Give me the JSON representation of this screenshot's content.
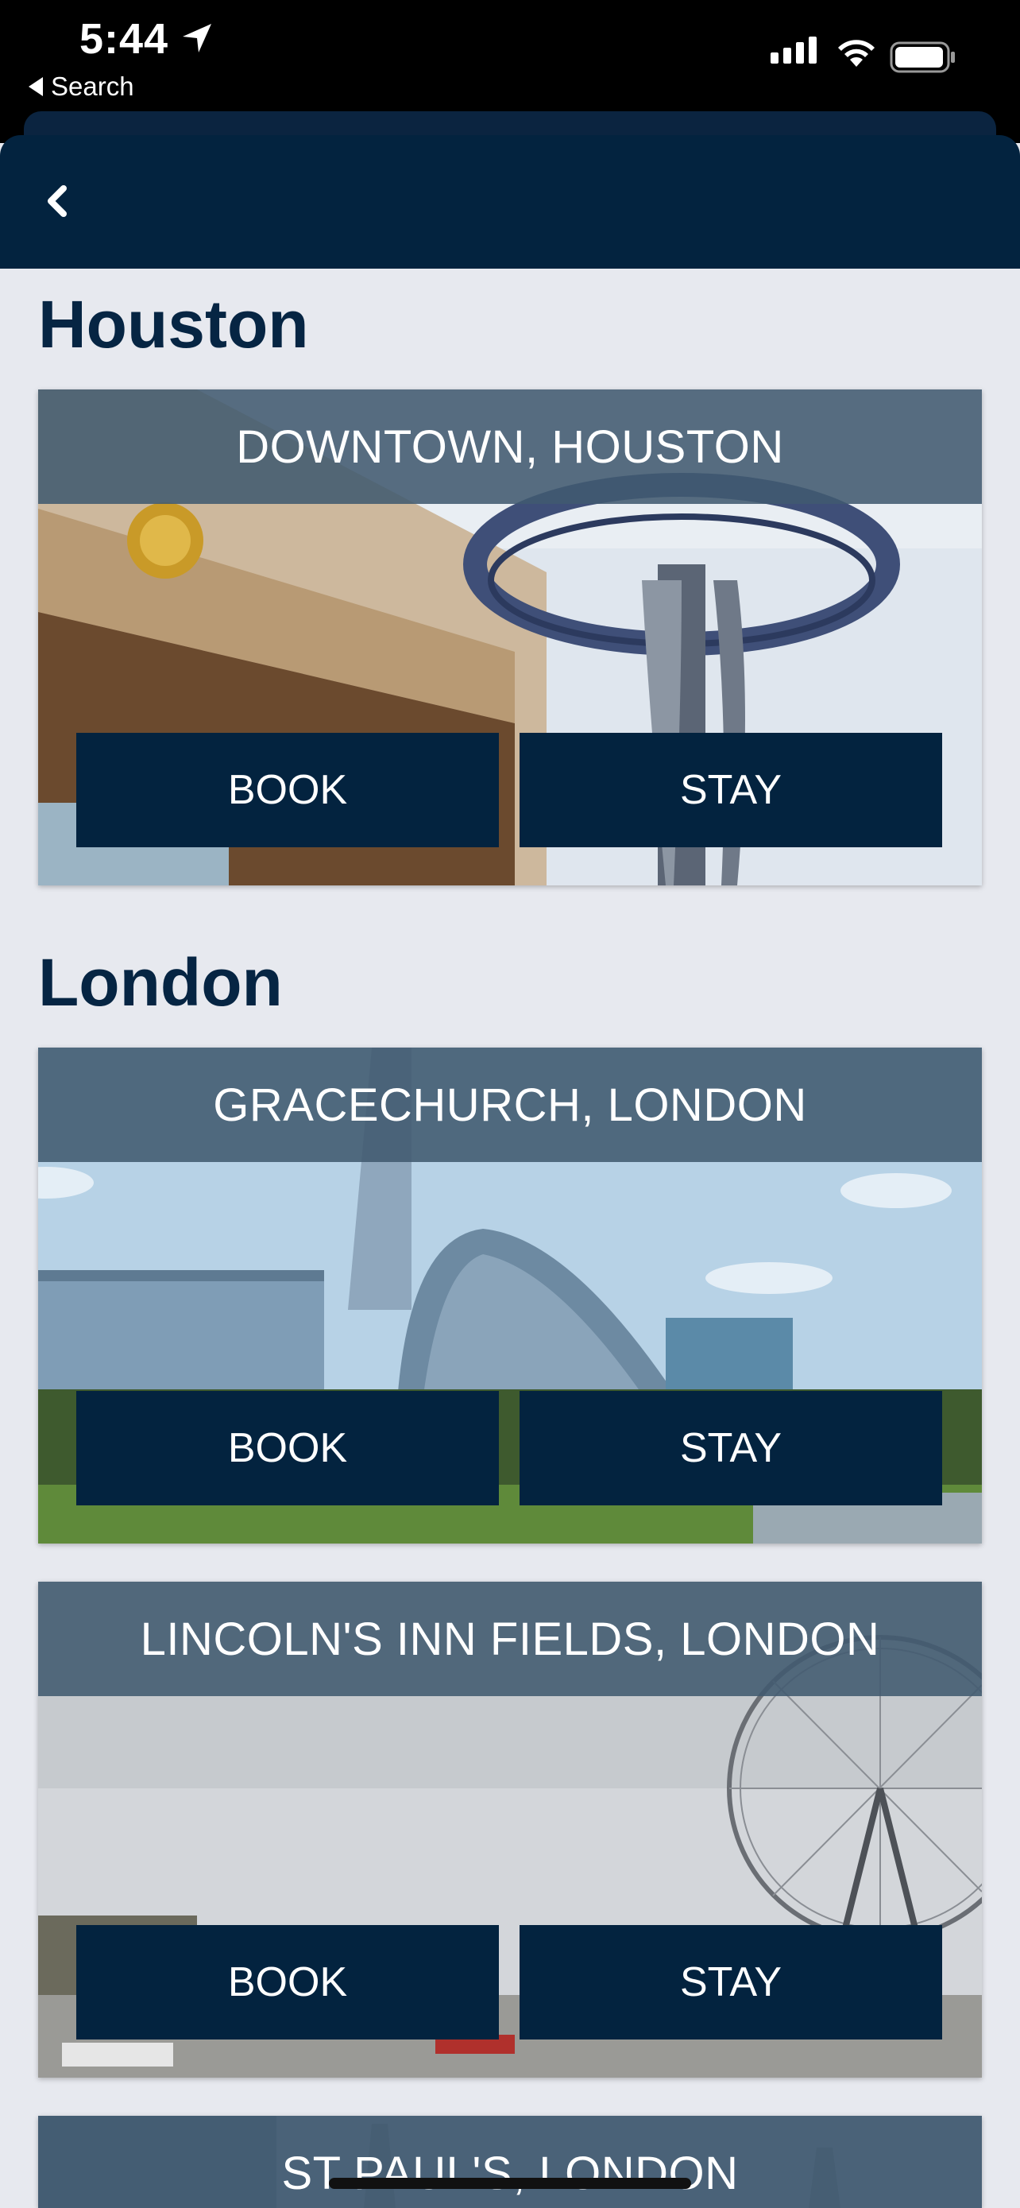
{
  "status_bar": {
    "time": "5:44",
    "back_label": "Search",
    "icons": [
      "location-arrow-icon",
      "cellular-signal-icon",
      "wifi-icon",
      "battery-icon"
    ]
  },
  "header": {
    "back_icon": "chevron-left-icon"
  },
  "colors": {
    "header_bg": "#03233f",
    "page_bg": "#e7e9ef",
    "title_band": "#415a70",
    "button_bg": "#03233f",
    "heading": "#062543"
  },
  "sections": [
    {
      "title": "Houston",
      "locations": [
        {
          "name": "DOWNTOWN, HOUSTON",
          "book_label": "BOOK",
          "stay_label": "STAY"
        }
      ]
    },
    {
      "title": "London",
      "locations": [
        {
          "name": "GRACECHURCH, LONDON",
          "book_label": "BOOK",
          "stay_label": "STAY"
        },
        {
          "name": "LINCOLN'S INN FIELDS, LONDON",
          "book_label": "BOOK",
          "stay_label": "STAY"
        },
        {
          "name": "ST PAUL'S, LONDON"
        }
      ]
    }
  ]
}
